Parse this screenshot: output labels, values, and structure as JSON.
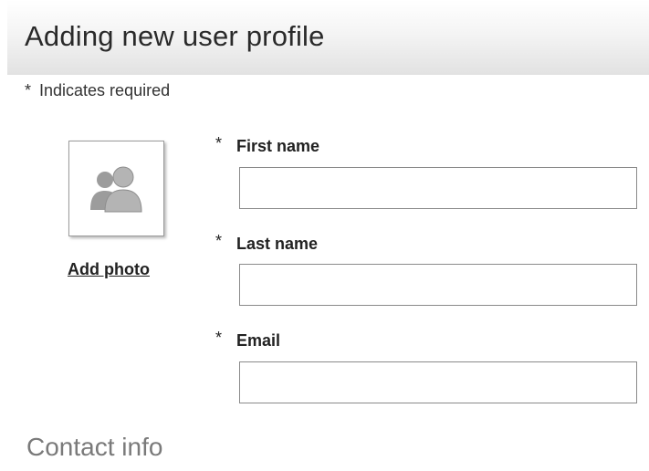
{
  "header": {
    "title": "Adding new user profile"
  },
  "required_note": {
    "marker": "*",
    "text": "Indicates required"
  },
  "photo": {
    "icon": "users-placeholder-icon",
    "add_label": "Add photo"
  },
  "form": {
    "fields": [
      {
        "marker": "*",
        "label": "First name",
        "value": ""
      },
      {
        "marker": "*",
        "label": "Last name",
        "value": ""
      },
      {
        "marker": "*",
        "label": "Email",
        "value": ""
      }
    ]
  },
  "sections": {
    "contact_title": "Contact info"
  }
}
